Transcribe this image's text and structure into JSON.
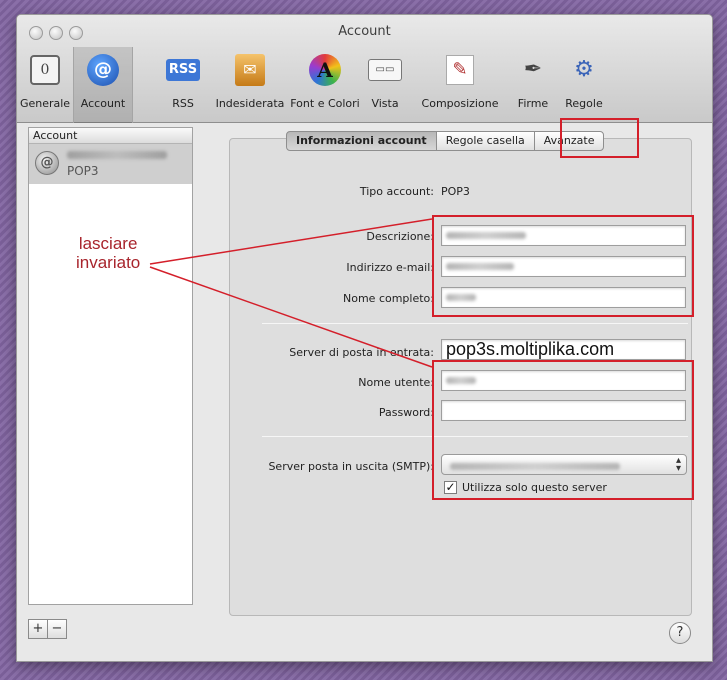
{
  "window": {
    "title": "Account"
  },
  "toolbar": {
    "items": [
      {
        "label": "Generale",
        "icon": "general-switch-icon"
      },
      {
        "label": "Account",
        "icon": "at-sign-icon",
        "selected": true
      },
      {
        "label": "RSS",
        "icon": "rss-icon"
      },
      {
        "label": "Indesiderata",
        "icon": "junk-mail-icon"
      },
      {
        "label": "Font e Colori",
        "icon": "font-colors-icon"
      },
      {
        "label": "Vista",
        "icon": "view-icon"
      },
      {
        "label": "Composizione",
        "icon": "compose-icon"
      },
      {
        "label": "Firme",
        "icon": "signature-pen-icon"
      },
      {
        "label": "Regole",
        "icon": "rules-icon"
      }
    ]
  },
  "sidebar": {
    "header": "Account",
    "account_type": "POP3"
  },
  "tabs": [
    {
      "label": "Informazioni account",
      "active": true
    },
    {
      "label": "Regole casella",
      "active": false
    },
    {
      "label": "Avanzate",
      "active": false
    }
  ],
  "form": {
    "tipo_label": "Tipo account:",
    "tipo_value": "POP3",
    "descrizione_label": "Descrizione:",
    "email_label": "Indirizzo e-mail:",
    "nome_completo_label": "Nome completo:",
    "server_entrata_label": "Server di posta in entrata:",
    "server_entrata_value": "pop3s.moltiplika.com",
    "nome_utente_label": "Nome utente:",
    "password_label": "Password:",
    "password_value": "",
    "smtp_label": "Server posta in uscita (SMTP):",
    "solo_server_label": "Utilizza solo questo server",
    "solo_server_checked": true
  },
  "annotation": {
    "line1": "lasciare",
    "line2": "invariato",
    "color": "#a8242c"
  },
  "buttons": {
    "add": "+",
    "remove": "−",
    "help": "?"
  }
}
